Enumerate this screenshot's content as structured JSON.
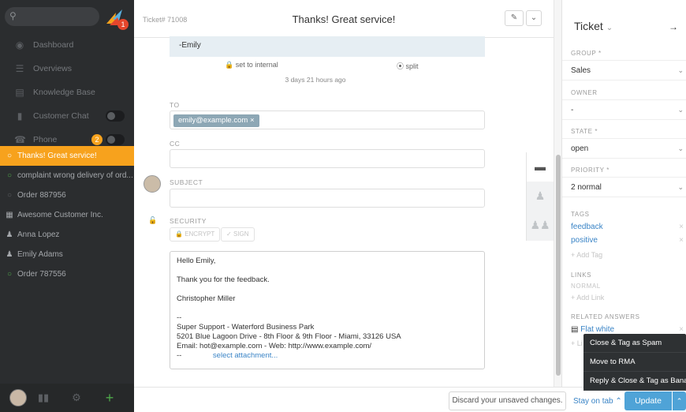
{
  "sidebar": {
    "nav": [
      {
        "label": "Dashboard",
        "icon": "dashboard-icon"
      },
      {
        "label": "Overviews",
        "icon": "list-icon"
      },
      {
        "label": "Knowledge Base",
        "icon": "book-icon"
      },
      {
        "label": "Customer Chat",
        "icon": "chat-icon"
      },
      {
        "label": "Phone",
        "icon": "phone-icon",
        "badge": "2"
      }
    ],
    "logo_badge": "1",
    "tasks": [
      {
        "label": "Thanks! Great service!",
        "active": true
      },
      {
        "label": "complaint wrong delivery of ord..."
      },
      {
        "label": "Order 887956"
      },
      {
        "label": "Awesome Customer Inc."
      },
      {
        "label": "Anna Lopez"
      },
      {
        "label": "Emily Adams"
      },
      {
        "label": "Order 787556"
      }
    ]
  },
  "ticket": {
    "number": "Ticket# 71008",
    "title": "Thanks! Great service!",
    "prev_article_text": "-Emily",
    "set_internal": "set to internal",
    "split": "split",
    "time_ago": "3 days 21 hours ago",
    "to_label": "TO",
    "to_token": "emily@example.com ×",
    "cc_label": "CC",
    "subject_label": "SUBJECT",
    "security_label": "SECURITY",
    "encrypt": "ENCRYPT",
    "sign": "SIGN",
    "body_lines": [
      "Hello Emily,",
      "",
      "Thank you for the feedback.",
      "",
      "Christopher Miller",
      "",
      "--",
      "Super Support - Waterford Business Park",
      "5201 Blue Lagoon Drive - 8th Floor & 9th Floor - Miami, 33126 USA",
      "Email: hot@example.com - Web: http://www.example.com/",
      "--"
    ],
    "select_attachment": "select attachment..."
  },
  "panel": {
    "title": "Ticket",
    "group_label": "GROUP *",
    "group_value": "Sales",
    "owner_label": "OWNER",
    "owner_value": "-",
    "state_label": "STATE *",
    "state_value": "open",
    "priority_label": "PRIORITY *",
    "priority_value": "2 normal",
    "tags_label": "TAGS",
    "tags": [
      "feedback",
      "positive"
    ],
    "add_tag": "+ Add Tag",
    "links_label": "LINKS",
    "links_normal": "NORMAL",
    "add_link": "+ Add Link",
    "related_label": "RELATED ANSWERS",
    "related_item": "Flat white",
    "add_related": "+ Li"
  },
  "bottom": {
    "discard": "Discard your unsaved changes.",
    "stay": "Stay on tab",
    "update": "Update"
  },
  "menu": [
    "Close & Tag as Spam",
    "Move to RMA",
    "Reply & Close & Tag as Banana"
  ]
}
